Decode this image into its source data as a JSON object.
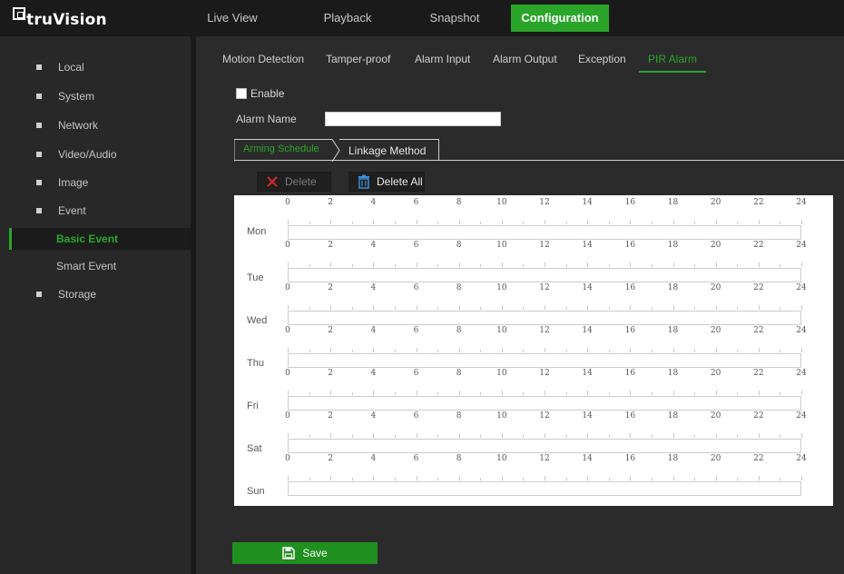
{
  "brand": {
    "name": "truVision"
  },
  "nav": {
    "tabs": [
      {
        "label": "Live View",
        "active": false
      },
      {
        "label": "Playback",
        "active": false
      },
      {
        "label": "Snapshot",
        "active": false
      },
      {
        "label": "Configuration",
        "active": true
      }
    ]
  },
  "sidebar": {
    "items": [
      {
        "label": "Local",
        "level": 1,
        "active": false
      },
      {
        "label": "System",
        "level": 1,
        "active": false
      },
      {
        "label": "Network",
        "level": 1,
        "active": false
      },
      {
        "label": "Video/Audio",
        "level": 1,
        "active": false
      },
      {
        "label": "Image",
        "level": 1,
        "active": false
      },
      {
        "label": "Event",
        "level": 1,
        "active": false
      },
      {
        "label": "Basic Event",
        "level": 2,
        "active": true
      },
      {
        "label": "Smart Event",
        "level": 2,
        "active": false
      },
      {
        "label": "Storage",
        "level": 1,
        "active": false
      }
    ]
  },
  "subtabs": [
    {
      "label": "Motion Detection",
      "active": false
    },
    {
      "label": "Tamper-proof",
      "active": false
    },
    {
      "label": "Alarm Input",
      "active": false
    },
    {
      "label": "Alarm Output",
      "active": false
    },
    {
      "label": "Exception",
      "active": false
    },
    {
      "label": "PIR Alarm",
      "active": true
    }
  ],
  "form": {
    "enable_label": "Enable",
    "enable_checked": false,
    "alarm_name_label": "Alarm Name",
    "alarm_name_value": ""
  },
  "schedule_tabs": {
    "arming": "Arming Schedule",
    "linkage": "Linkage Method",
    "active": "arming"
  },
  "actions": {
    "delete_label": "Delete",
    "delete_all_label": "Delete All",
    "save_label": "Save"
  },
  "schedule": {
    "days": [
      "Mon",
      "Tue",
      "Wed",
      "Thu",
      "Fri",
      "Sat",
      "Sun"
    ],
    "hours": [
      "0",
      "2",
      "4",
      "6",
      "8",
      "10",
      "12",
      "14",
      "16",
      "18",
      "20",
      "22",
      "24"
    ]
  },
  "colors": {
    "accent": "#2aa52a",
    "topbar": "#1a1a1a",
    "sidebar": "#282828",
    "panel": "#2b2b2b",
    "delete_icon": "#cc2a2a",
    "trash_icon": "#3d8fd6"
  },
  "icons": {
    "logo": "truvision-logo-icon",
    "delete": "red-x-icon",
    "delete_all": "trash-icon",
    "save": "floppy-disk-icon"
  }
}
